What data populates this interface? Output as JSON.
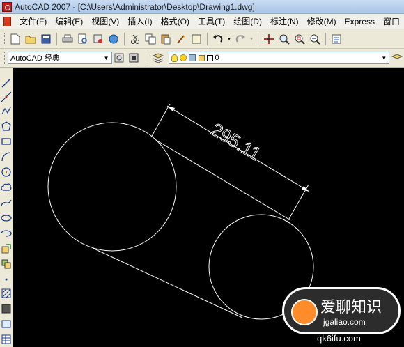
{
  "titlebar": {
    "title": "AutoCAD 2007 - [C:\\Users\\Administrator\\Desktop\\Drawing1.dwg]"
  },
  "menubar": {
    "items": [
      "文件(F)",
      "编辑(E)",
      "视图(V)",
      "插入(I)",
      "格式(O)",
      "工具(T)",
      "绘图(D)",
      "标注(N)",
      "修改(M)",
      "Express",
      "窗口"
    ]
  },
  "workspace": {
    "value": "AutoCAD 经典"
  },
  "layer": {
    "value": "0"
  },
  "drawing": {
    "dimension_text": "295.11",
    "line_color": "#ffffff",
    "background": "#000000"
  },
  "watermark": {
    "name": "爱聊知识",
    "url": "jgaliao.com",
    "url2": "qk6ifu.com"
  }
}
